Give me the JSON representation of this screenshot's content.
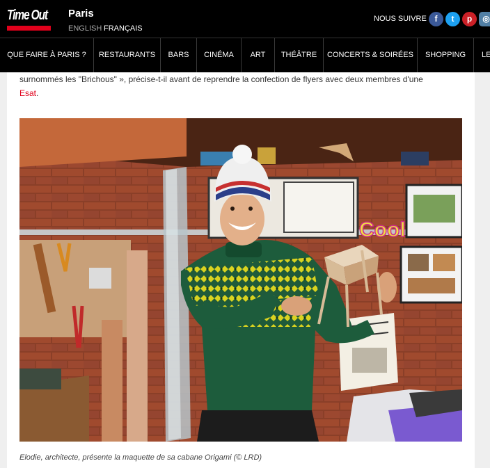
{
  "brand": {
    "logo_text": "Time Out",
    "city": "Paris"
  },
  "language": {
    "english": "ENGLISH",
    "french": "FRANÇAIS"
  },
  "social": {
    "follow_label": "NOUS SUIVRE",
    "facebook": "f",
    "twitter": "t",
    "pinterest": "p",
    "instagram": "◎"
  },
  "nav": {
    "items": [
      "QUE FAIRE À PARIS ?",
      "RESTAURANTS",
      "BARS",
      "CINÉMA",
      "ART",
      "THÉÂTRE",
      "CONCERTS & SOIRÉES",
      "SHOPPING",
      "LE"
    ]
  },
  "article": {
    "line1": "surnommés les \"Brichous\" », précise-t-il avant de reprendre la confection de flyers avec deux membres d'une",
    "line2_link": "Esat",
    "line2_end": ".",
    "photo_wall_text": "Cool",
    "caption": "Elodie, architecte, présente la maquette de sa cabane Origami (© LRD)"
  }
}
